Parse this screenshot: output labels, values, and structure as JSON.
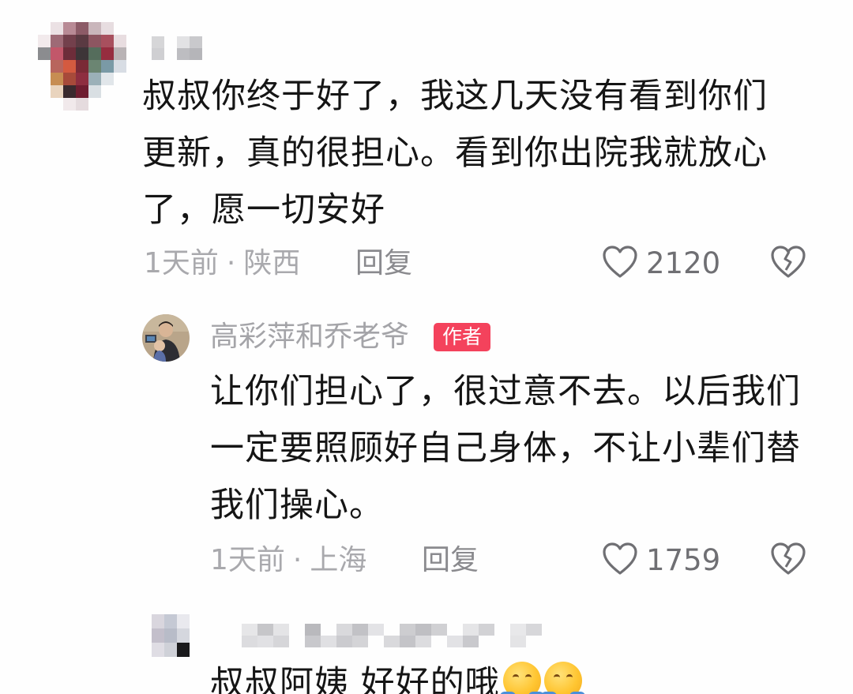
{
  "comments": [
    {
      "text_lines": [
        "叔叔你终于好了，我这几天没有看到你们",
        "更新，真的很担心。看到你出院我就放心",
        "了，愿一切安好"
      ],
      "time": "1天前",
      "separator": "·",
      "location": "陕西",
      "reply_label": "回复",
      "likes": "2120",
      "avatar_icon": "pixelated-avatar",
      "username_censored": true
    },
    {
      "username": "高彩萍和乔老爷",
      "badge": "作者",
      "text_lines": [
        "让你们担心了，很过意不去。以后我们",
        "一定要照顾好自己身体，不让小辈们替",
        "我们操心。"
      ],
      "time": "1天前",
      "separator": "·",
      "location": "上海",
      "reply_label": "回复",
      "likes": "1759",
      "avatar_icon": "author-photo-avatar"
    },
    {
      "text": "叔叔阿姨 好好的哦",
      "emojis": [
        "hugging-face-emoji",
        "hugging-face-emoji"
      ],
      "avatar_icon": "pixelated-avatar",
      "username_censored": true
    }
  ],
  "icons": {
    "like": "heart-outline-icon",
    "dislike": "broken-heart-icon"
  },
  "colors": {
    "badge": "#f4425c",
    "text": "#151515",
    "meta": "#a9a9ad"
  }
}
